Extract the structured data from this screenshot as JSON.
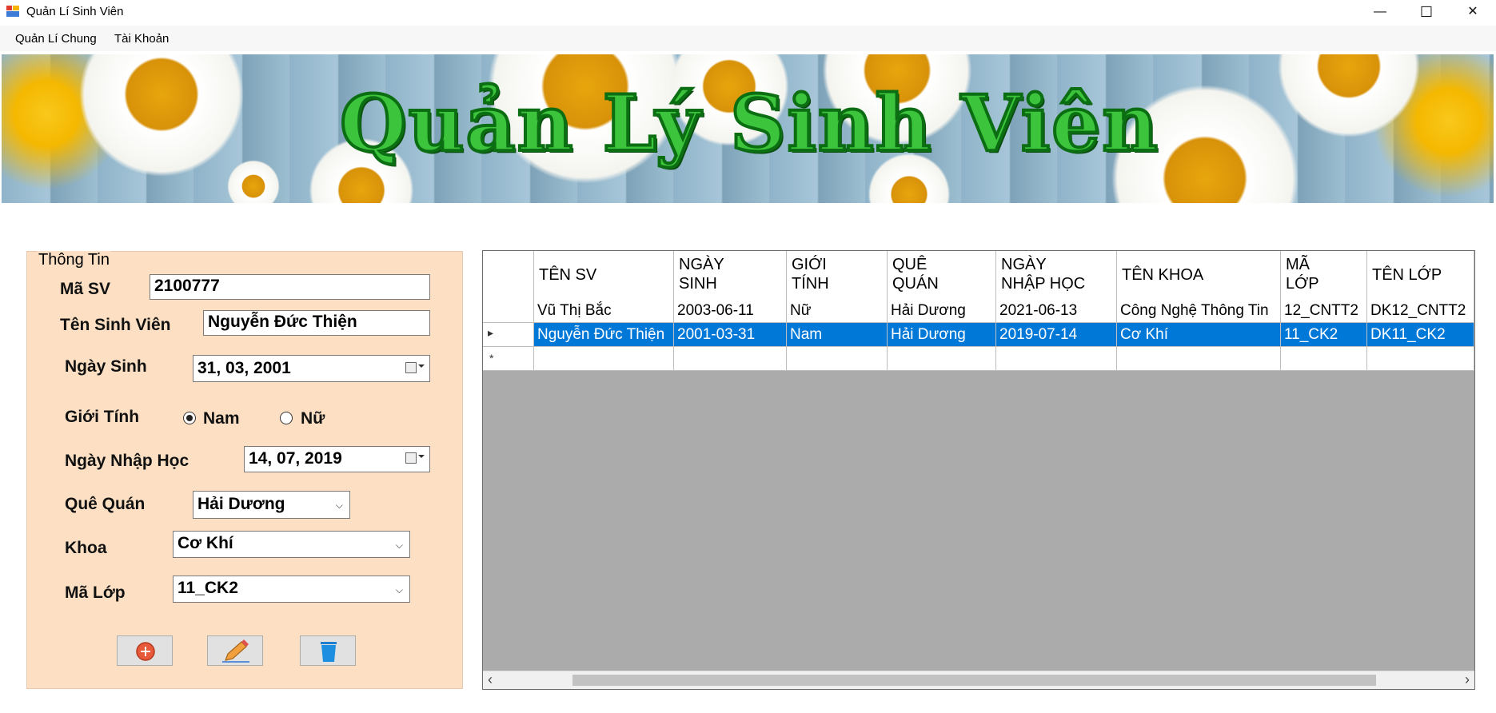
{
  "window": {
    "title": "Quản Lí Sinh Viên",
    "minimize": "—",
    "maximize": "☐",
    "close": "✕"
  },
  "menu": {
    "items": [
      "Quản Lí Chung",
      "Tài Khoản"
    ]
  },
  "banner": {
    "title": "Quản Lý Sinh Viên"
  },
  "form": {
    "legend": "Thông Tin",
    "ma_sv_label": "Mã SV",
    "ma_sv_value": "2100777",
    "ten_label": "Tên Sinh Viên",
    "ten_value": "Nguyễn Đức Thiện",
    "ngay_sinh_label": "Ngày Sinh",
    "ngay_sinh_value": "31, 03, 2001",
    "gioi_tinh_label": "Giới Tính",
    "nam_label": "Nam",
    "nu_label": "Nữ",
    "gioi_tinh_selected": "Nam",
    "ngay_nhap_hoc_label": "Ngày Nhập Học",
    "ngay_nhap_hoc_value": "14, 07, 2019",
    "que_quan_label": "Quê Quán",
    "que_quan_value": "Hải Dương",
    "khoa_label": "Khoa",
    "khoa_value": "Cơ Khí",
    "ma_lop_label": "Mã Lớp",
    "ma_lop_value": "11_CK2",
    "buttons": {
      "add_icon": "add-circle-icon",
      "edit_icon": "pencil-icon",
      "delete_icon": "trash-icon"
    }
  },
  "grid": {
    "columns": [
      "TÊN SV",
      "NGÀY\nSINH",
      "GIỚI\nTÍNH",
      "QUÊ\nQUÁN",
      "NGÀY\nNHẬP HỌC",
      "TÊN KHOA",
      "MÃ\nLỚP",
      "TÊN LỚP"
    ],
    "rows": [
      [
        "Vũ Thị Bắc",
        "2003-06-11",
        "Nữ",
        "Hải Dương",
        "2021-06-13",
        "Công Nghệ Thông Tin",
        "12_CNTT2",
        "DK12_CNTT2"
      ],
      [
        "Nguyễn Đức Thiện",
        "2001-03-31",
        "Nam",
        "Hải Dương",
        "2019-07-14",
        "Cơ Khí",
        "11_CK2",
        "DK11_CK2"
      ]
    ],
    "selected_row": 1,
    "current_row_marker": "▸",
    "new_row_marker": "*",
    "scroll_left": "‹",
    "scroll_right": "›"
  }
}
